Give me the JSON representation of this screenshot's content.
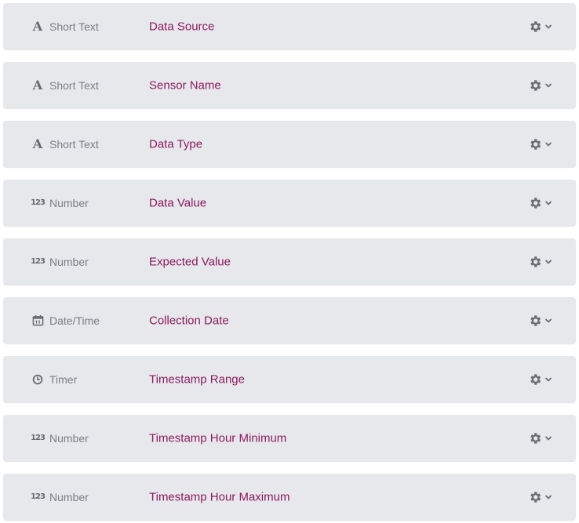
{
  "fields": [
    {
      "type_icon": "letter-a-icon",
      "type_label": "Short Text",
      "name": "Data Source"
    },
    {
      "type_icon": "letter-a-icon",
      "type_label": "Short Text",
      "name": "Sensor Name"
    },
    {
      "type_icon": "letter-a-icon",
      "type_label": "Short Text",
      "name": "Data Type"
    },
    {
      "type_icon": "numeric-123-icon",
      "type_label": "Number",
      "name": "Data Value"
    },
    {
      "type_icon": "numeric-123-icon",
      "type_label": "Number",
      "name": "Expected Value"
    },
    {
      "type_icon": "calendar-icon",
      "type_label": "Date/Time",
      "name": "Collection Date"
    },
    {
      "type_icon": "clock-icon",
      "type_label": "Timer",
      "name": "Timestamp Range"
    },
    {
      "type_icon": "numeric-123-icon",
      "type_label": "Number",
      "name": "Timestamp Hour Minimum"
    },
    {
      "type_icon": "numeric-123-icon",
      "type_label": "Number",
      "name": "Timestamp Hour Maximum"
    }
  ],
  "icon_glyphs": {
    "letter_a": "A",
    "numeric_123": "123"
  },
  "colors": {
    "row_background": "#e7e8ec",
    "field_name": "#8b1a5f",
    "type_label": "#7a7e84",
    "icon": "#666a70"
  }
}
